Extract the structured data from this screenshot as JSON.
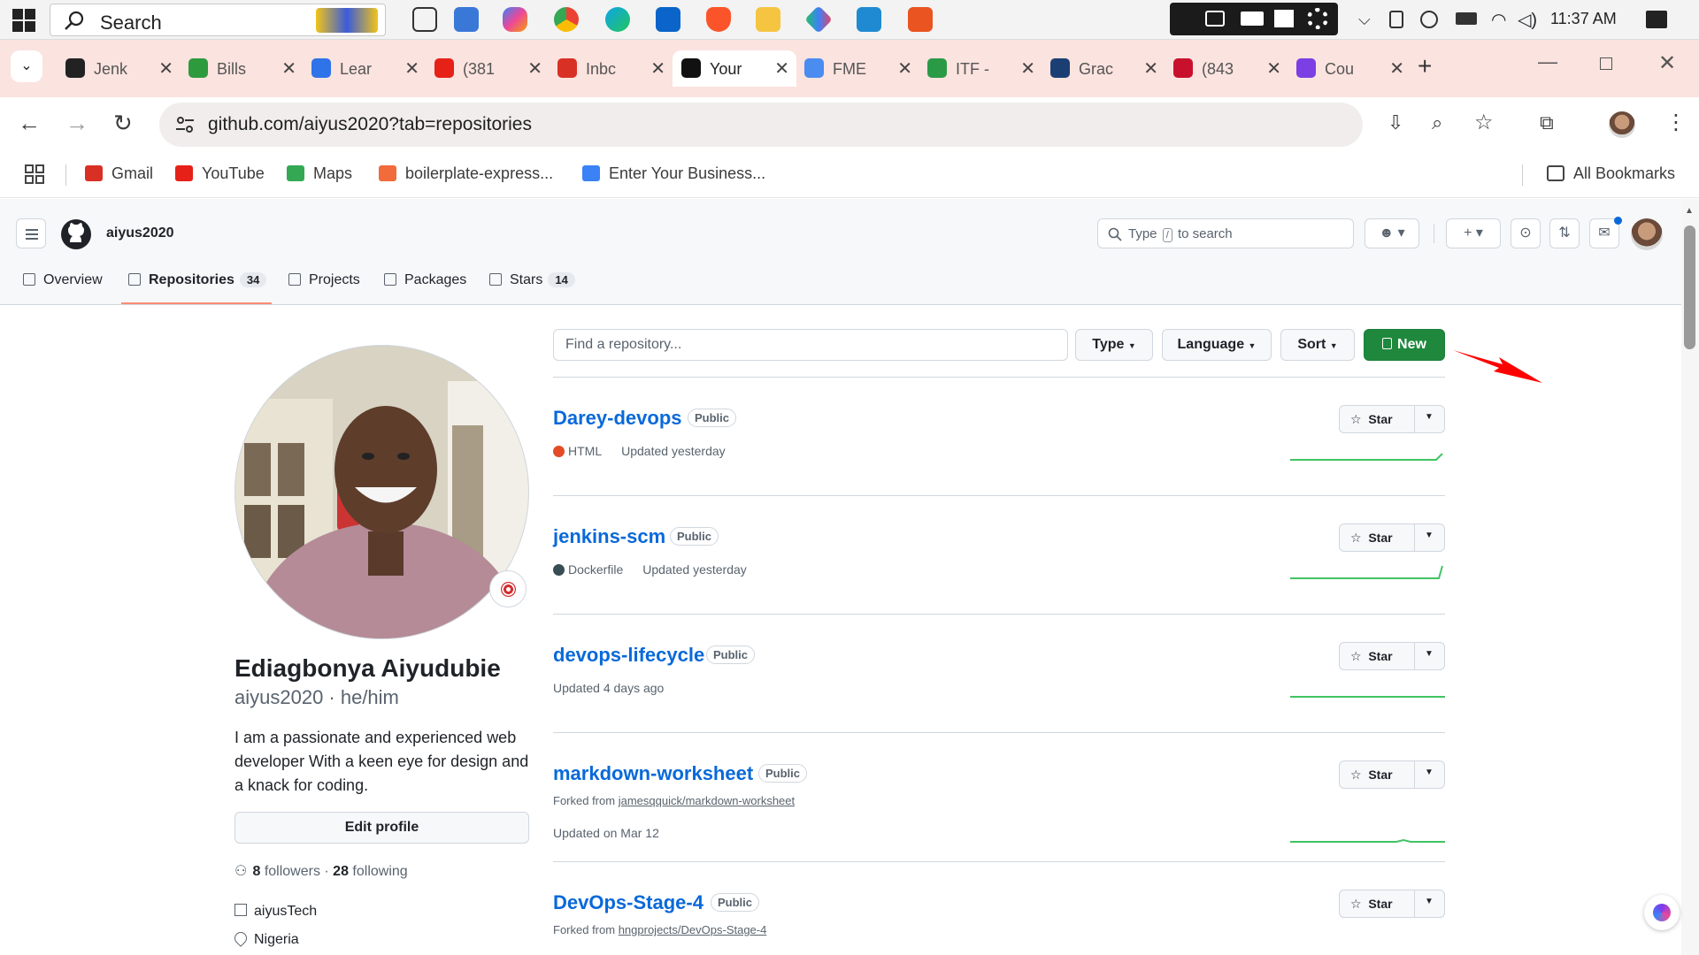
{
  "taskbar": {
    "search_label": "Search",
    "clock": "11:37 AM",
    "apps": [
      "clapperboard-icon",
      "task-view-icon",
      "store-icon",
      "copilot-icon",
      "chrome-icon",
      "edge-icon",
      "outlook-icon",
      "brave-icon",
      "file-explorer-icon",
      "app-icon",
      "vscode-icon",
      "ubuntu-icon"
    ]
  },
  "tabs": [
    {
      "title": "Jenk",
      "icon": "openai-icon",
      "color": "#222222"
    },
    {
      "title": "Bills",
      "icon": "bills-icon",
      "color": "#2e9a3e"
    },
    {
      "title": "Lear",
      "icon": "learn-icon",
      "color": "#2f73e8"
    },
    {
      "title": "(381",
      "icon": "youtube-icon",
      "color": "#e62117"
    },
    {
      "title": "Inbc",
      "icon": "gmail-icon",
      "color": "#d93025"
    },
    {
      "title": "Your",
      "icon": "github-icon",
      "color": "#111111",
      "active": true
    },
    {
      "title": "FME",
      "icon": "fme-icon",
      "color": "#4a8cf0"
    },
    {
      "title": "ITF -",
      "icon": "supa-icon",
      "color": "#2b9a47"
    },
    {
      "title": "Grac",
      "icon": "grac-icon",
      "color": "#1c3f73"
    },
    {
      "title": "(843",
      "icon": "mail-icon",
      "color": "#c8102e"
    },
    {
      "title": "Cou",
      "icon": "course-icon",
      "color": "#7b3fe4"
    }
  ],
  "address": {
    "url": "github.com/aiyus2020?tab=repositories"
  },
  "bookmarks": [
    {
      "label": "Gmail",
      "color": "#d93025"
    },
    {
      "label": "YouTube",
      "color": "#e62117"
    },
    {
      "label": "Maps",
      "color": "#34a853"
    },
    {
      "label": "boilerplate-express...",
      "color": "#f26b3a"
    },
    {
      "label": "Enter Your Business...",
      "color": "#3b82f6"
    }
  ],
  "bookmarks_all": "All Bookmarks",
  "github": {
    "username": "aiyus2020",
    "search_prefix": "Type",
    "search_key": "/",
    "search_suffix": "to search",
    "nav": [
      {
        "label": "Overview",
        "icon": "book-icon"
      },
      {
        "label": "Repositories",
        "count": "34",
        "icon": "repo-icon",
        "selected": true
      },
      {
        "label": "Projects",
        "icon": "table-icon"
      },
      {
        "label": "Packages",
        "icon": "package-icon"
      },
      {
        "label": "Stars",
        "count": "14",
        "icon": "star-icon"
      }
    ]
  },
  "profile": {
    "name": "Ediagbonya Aiyudubie",
    "login_line": "aiyus2020 · he/him",
    "bio": "I am a passionate and experienced web developer With a keen eye for design and a knack for coding.",
    "edit_label": "Edit profile",
    "followers": "8",
    "followers_label": "followers",
    "following": "28",
    "following_label": "following",
    "company": "aiyusTech",
    "location": "Nigeria"
  },
  "repo_filters": {
    "find_placeholder": "Find a repository...",
    "type_label": "Type",
    "language_label": "Language",
    "sort_label": "Sort",
    "new_label": "New"
  },
  "repos": [
    {
      "name": "Darey-devops",
      "visibility": "Public",
      "language": "HTML",
      "lang_color": "#e34c26",
      "updated": "Updated yesterday",
      "forked_from": "",
      "star_label": "Star"
    },
    {
      "name": "jenkins-scm",
      "visibility": "Public",
      "language": "Dockerfile",
      "lang_color": "#384d54",
      "updated": "Updated yesterday",
      "forked_from": "",
      "star_label": "Star"
    },
    {
      "name": "devops-lifecycle",
      "visibility": "Public",
      "language": "",
      "lang_color": "",
      "updated": "Updated 4 days ago",
      "forked_from": "",
      "star_label": "Star"
    },
    {
      "name": "markdown-worksheet",
      "visibility": "Public",
      "language": "",
      "lang_color": "",
      "updated": "Updated on Mar 12",
      "forked_prefix": "Forked from",
      "forked_from": "jamesqquick/markdown-worksheet",
      "star_label": "Star"
    },
    {
      "name": "DevOps-Stage-4",
      "visibility": "Public",
      "language": "",
      "lang_color": "",
      "updated": "",
      "forked_prefix": "Forked from",
      "forked_from": "hngprojects/DevOps-Stage-4",
      "star_label": "Star"
    }
  ],
  "colors": {
    "accent": "#0969da",
    "new_button": "#1f883d",
    "annotation_arrow": "#ff0000",
    "tab_strip": "#fbe3df"
  }
}
